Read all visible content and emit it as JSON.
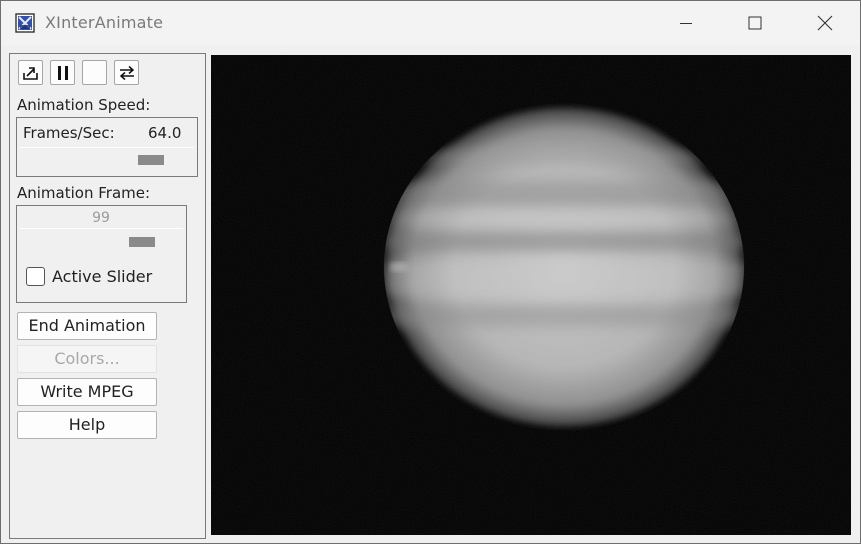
{
  "window": {
    "title": "XInterAnimate"
  },
  "toolbar": {
    "icons": [
      "reverse-play-icon",
      "pause-icon",
      "blank-icon",
      "cycle-direction-icon"
    ]
  },
  "speed": {
    "heading": "Animation Speed:",
    "field_label": "Frames/Sec:",
    "value": "64.0",
    "slider_fraction": 0.8
  },
  "frame": {
    "heading": "Animation Frame:",
    "value": "99",
    "slider_fraction": 0.8,
    "active_slider_label": "Active Slider",
    "active_slider_checked": false
  },
  "buttons": {
    "end": "End Animation",
    "colors": "Colors...",
    "mpeg": "Write MPEG",
    "help": "Help"
  },
  "colors": {
    "background": "#f0f0f0",
    "display": "#000000"
  }
}
